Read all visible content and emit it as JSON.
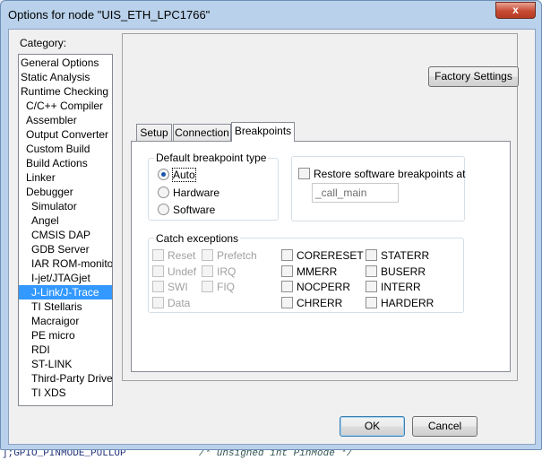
{
  "window": {
    "title": "Options for node \"UIS_ETH_LPC1766\"",
    "close_label": "x"
  },
  "background": {
    "code_left": "];GPIO_PINMODE_PULLUP",
    "code_right": "/* unsigned int PinMode */"
  },
  "category": {
    "label": "Category:",
    "items": [
      "General Options",
      "Static Analysis",
      "Runtime Checking",
      "C/C++ Compiler",
      "Assembler",
      "Output Converter",
      "Custom Build",
      "Build Actions",
      "Linker",
      "Debugger",
      "Simulator",
      "Angel",
      "CMSIS DAP",
      "GDB Server",
      "IAR ROM-monitor",
      "I-jet/JTAGjet",
      "J-Link/J-Trace",
      "TI Stellaris",
      "Macraigor",
      "PE micro",
      "RDI",
      "ST-LINK",
      "Third-Party Driver",
      "TI XDS"
    ],
    "selected": "J-Link/J-Trace"
  },
  "factory_settings_label": "Factory Settings",
  "tabs": [
    "Setup",
    "Connection",
    "Breakpoints"
  ],
  "active_tab": "Breakpoints",
  "default_bp": {
    "title": "Default breakpoint type",
    "options": [
      "Auto",
      "Hardware",
      "Software"
    ],
    "selected": "Auto"
  },
  "restore": {
    "label": "Restore software breakpoints at",
    "checked": false,
    "value": "_call_main"
  },
  "catch": {
    "title": "Catch exceptions",
    "col1": [
      "Reset",
      "Undef",
      "SWI",
      "Data"
    ],
    "col2": [
      "Prefetch",
      "IRQ",
      "FIQ"
    ],
    "col3": [
      "CORERESET",
      "MMERR",
      "NOCPERR",
      "CHRERR"
    ],
    "col4": [
      "STATERR",
      "BUSERR",
      "INTERR",
      "HARDERR"
    ]
  },
  "ok_label": "OK",
  "cancel_label": "Cancel"
}
